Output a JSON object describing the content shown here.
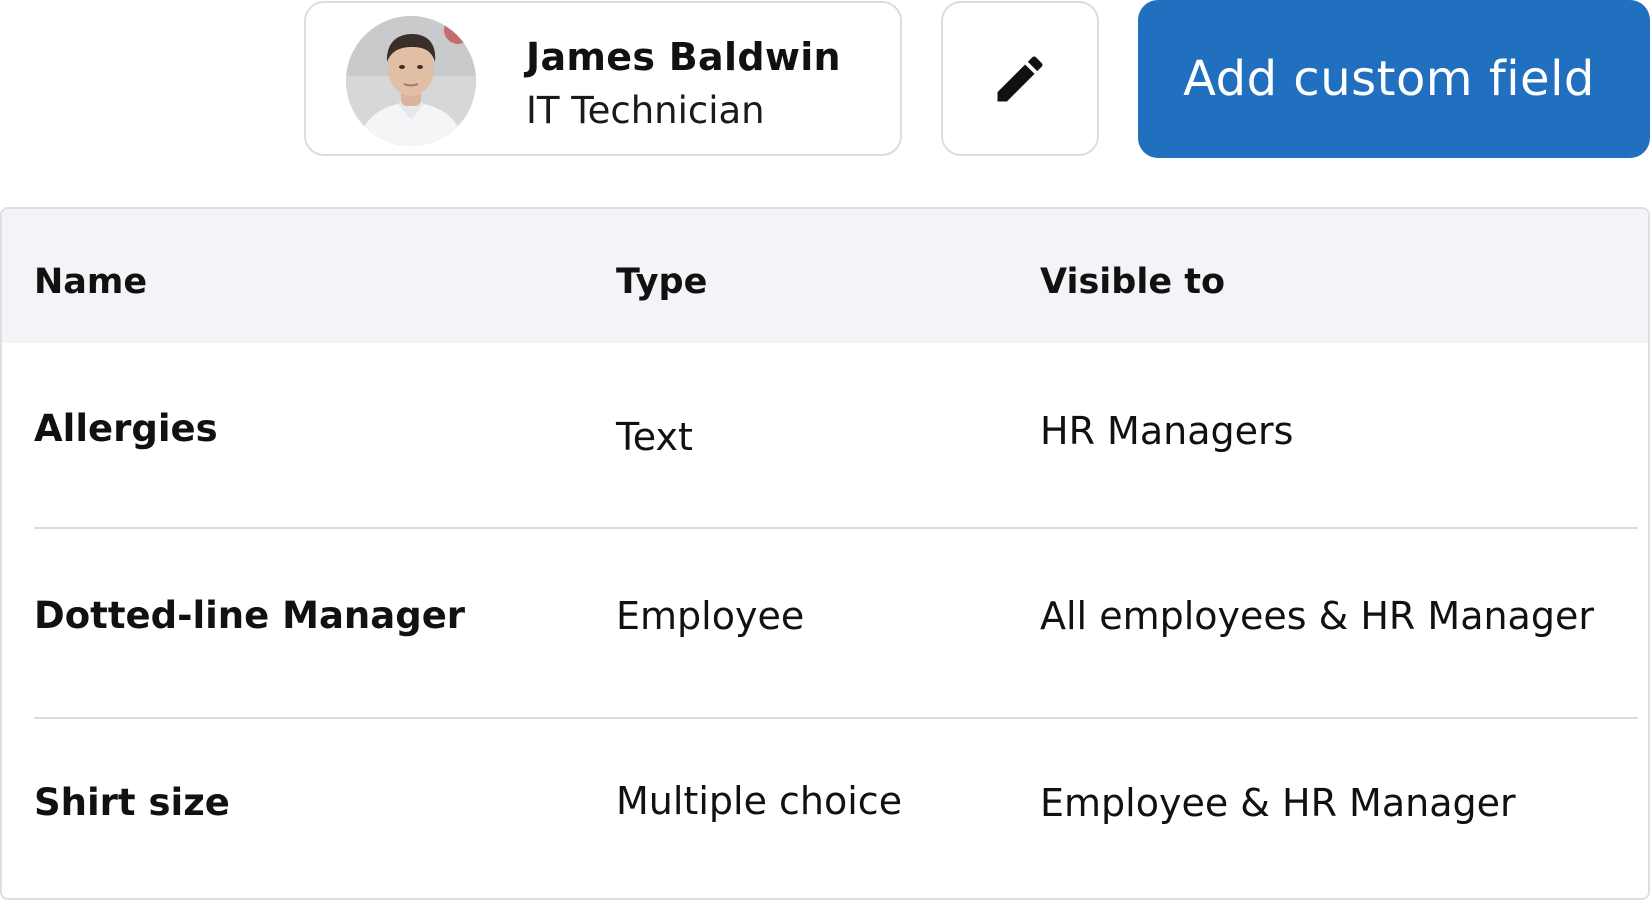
{
  "profile": {
    "name": "James Baldwin",
    "role": "IT Technician",
    "avatar_icon": "person-avatar"
  },
  "toolbar": {
    "edit_icon": "pencil-icon",
    "add_custom_field_label": "Add custom field",
    "accent_color": "#2070bf"
  },
  "table": {
    "columns": [
      "Name",
      "Type",
      "Visible to"
    ],
    "rows": [
      {
        "name": "Allergies",
        "type": "Text",
        "visible_to": "HR Managers"
      },
      {
        "name": "Dotted-line Manager",
        "type": "Employee",
        "visible_to": "All employees & HR Manager"
      },
      {
        "name": "Shirt size",
        "type": "Multiple choice",
        "visible_to": "Employee & HR Manager"
      }
    ]
  }
}
